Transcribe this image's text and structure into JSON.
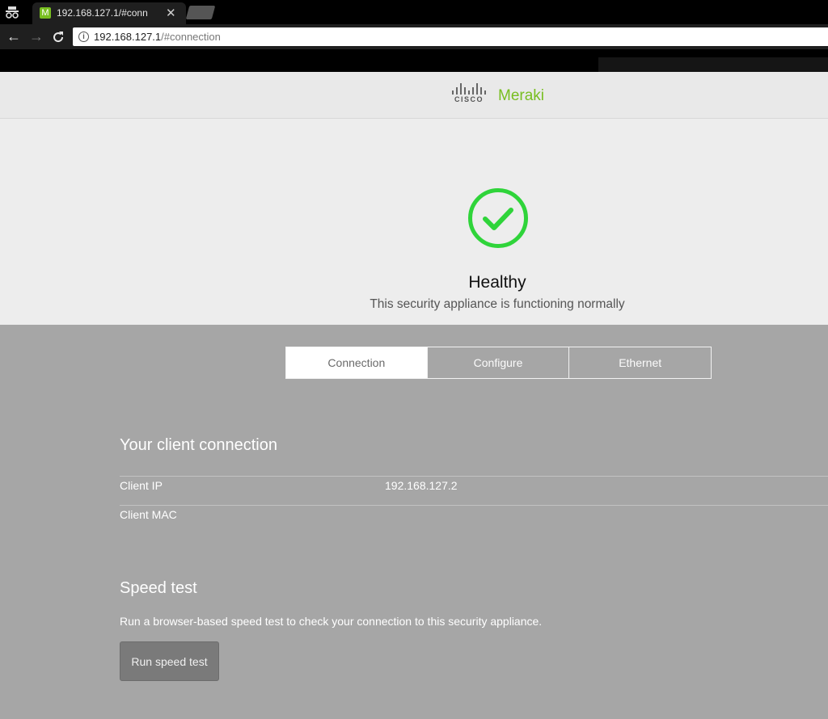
{
  "browser": {
    "tab": {
      "favicon": "M",
      "title": "192.168.127.1/#conn"
    },
    "url": {
      "host": "192.168.127.1",
      "path": "/#connection"
    }
  },
  "header": {
    "cisco": "CISCO",
    "brand": "Meraki"
  },
  "status": {
    "title": "Healthy",
    "subtitle": "This security appliance is functioning normally",
    "icon": "check-circle-icon",
    "color": "#2fd43a"
  },
  "tabs": [
    {
      "label": "Connection",
      "active": true
    },
    {
      "label": "Configure",
      "active": false
    },
    {
      "label": "Ethernet",
      "active": false
    }
  ],
  "client_connection": {
    "title": "Your client connection",
    "rows": [
      {
        "label": "Client IP",
        "value": "192.168.127.2"
      },
      {
        "label": "Client MAC",
        "value": ""
      }
    ]
  },
  "speed_test": {
    "title": "Speed test",
    "description": "Run a browser-based speed test to check your connection to this security appliance.",
    "button": "Run speed test"
  },
  "colors": {
    "brand_green": "#78be20",
    "content_bg": "#a6a6a6",
    "hero_bg": "#ededed"
  }
}
